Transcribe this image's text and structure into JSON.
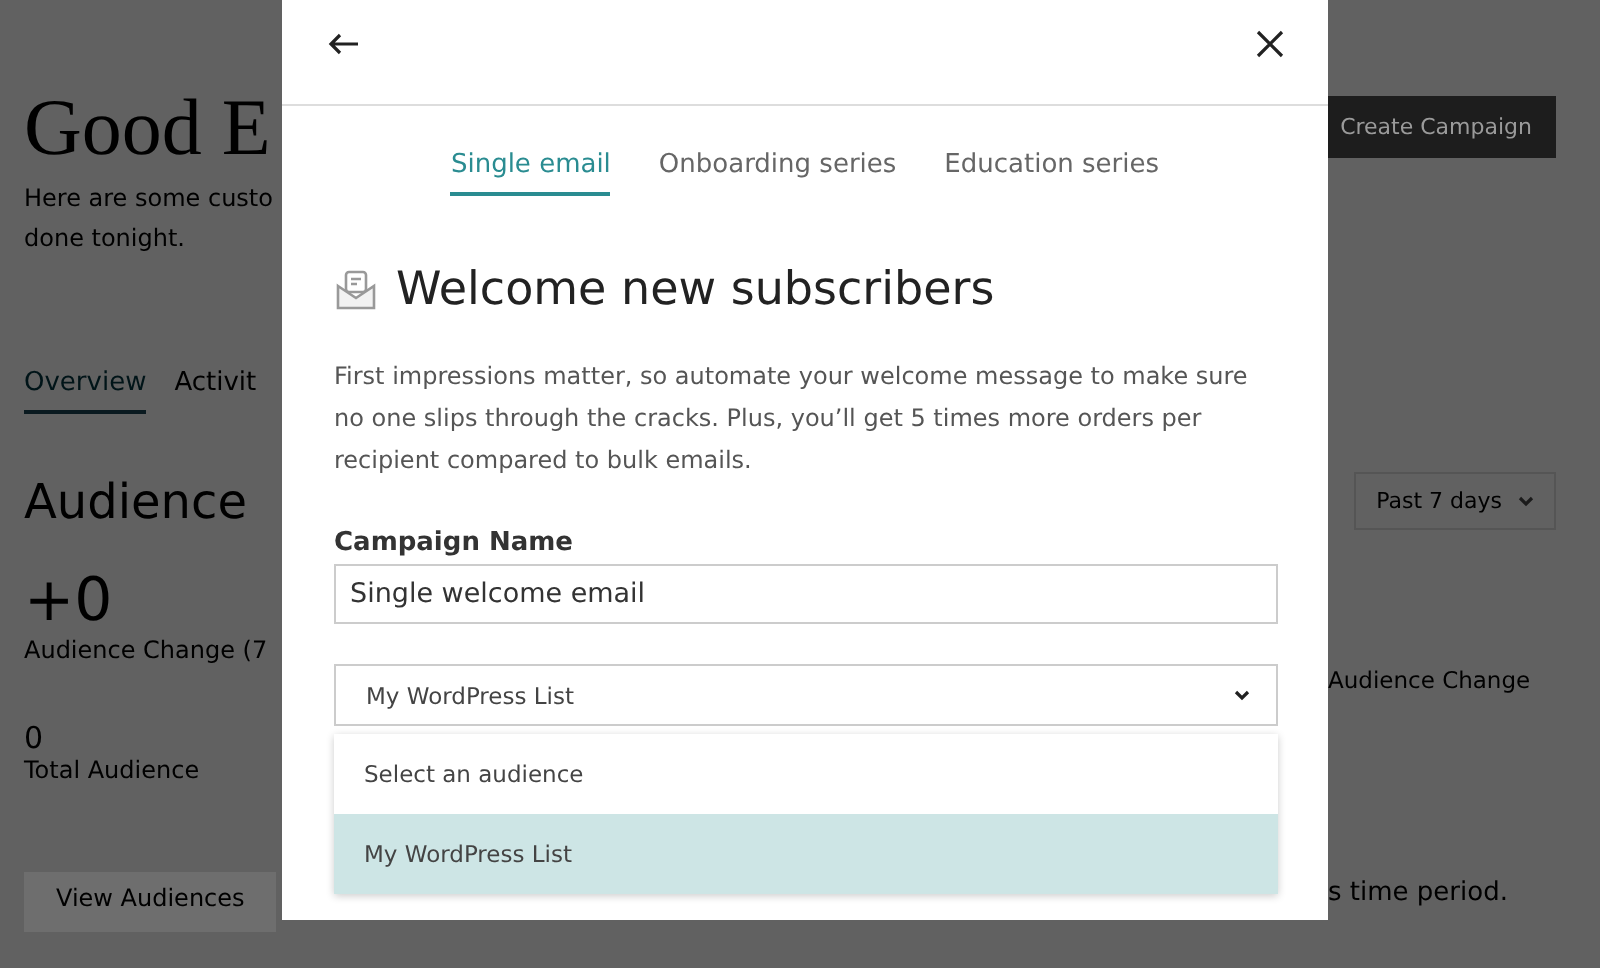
{
  "page": {
    "greeting": "Good E",
    "intro_lines": [
      "Here are some custo",
      "done tonight."
    ],
    "tabs": [
      {
        "label": "Overview",
        "selected": true
      },
      {
        "label": "Activit",
        "selected": false
      }
    ],
    "section_title": "Audience",
    "change_value": "+0",
    "change_label": "Audience Change (7",
    "total_value": "0",
    "total_label": "Total Audience",
    "view_button": "View Audiences",
    "create_button": "Create Campaign",
    "period_dropdown": "Past 7 days",
    "right_change_label": "Audience Change",
    "right_note": "s time period."
  },
  "modal": {
    "tabs": [
      {
        "label": "Single email",
        "selected": true
      },
      {
        "label": "Onboarding series",
        "selected": false
      },
      {
        "label": "Education series",
        "selected": false
      }
    ],
    "title": "Welcome new subscribers",
    "description": "First impressions matter, so automate your welcome message to make sure no one slips through the cracks. Plus, you’ll get 5 times more orders per recipient compared to bulk emails.",
    "campaign_name": {
      "label": "Campaign Name",
      "value": "Single welcome email"
    },
    "audience_select": {
      "value": "My WordPress List",
      "expanded": true,
      "options": [
        {
          "label": "Select an audience",
          "selected": false
        },
        {
          "label": "My WordPress List",
          "selected": true
        }
      ]
    }
  }
}
